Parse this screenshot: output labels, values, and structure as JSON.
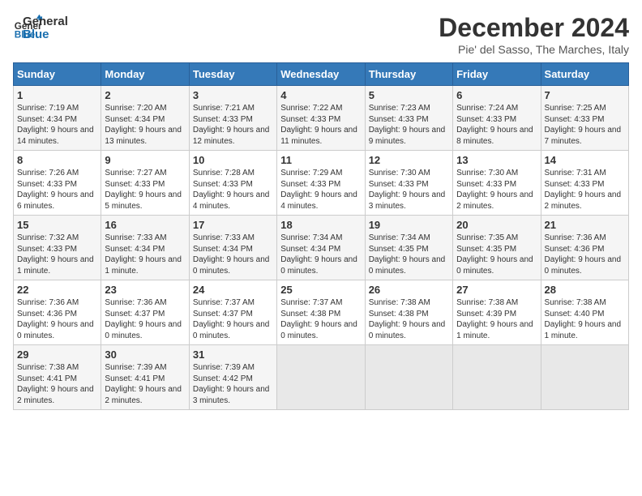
{
  "header": {
    "logo_general": "General",
    "logo_blue": "Blue",
    "main_title": "December 2024",
    "subtitle": "Pie' del Sasso, The Marches, Italy"
  },
  "weekdays": [
    "Sunday",
    "Monday",
    "Tuesday",
    "Wednesday",
    "Thursday",
    "Friday",
    "Saturday"
  ],
  "weeks": [
    [
      {
        "day": "1",
        "sunrise": "7:19 AM",
        "sunset": "4:34 PM",
        "daylight": "9 hours and 14 minutes."
      },
      {
        "day": "2",
        "sunrise": "7:20 AM",
        "sunset": "4:34 PM",
        "daylight": "9 hours and 13 minutes."
      },
      {
        "day": "3",
        "sunrise": "7:21 AM",
        "sunset": "4:33 PM",
        "daylight": "9 hours and 12 minutes."
      },
      {
        "day": "4",
        "sunrise": "7:22 AM",
        "sunset": "4:33 PM",
        "daylight": "9 hours and 11 minutes."
      },
      {
        "day": "5",
        "sunrise": "7:23 AM",
        "sunset": "4:33 PM",
        "daylight": "9 hours and 9 minutes."
      },
      {
        "day": "6",
        "sunrise": "7:24 AM",
        "sunset": "4:33 PM",
        "daylight": "9 hours and 8 minutes."
      },
      {
        "day": "7",
        "sunrise": "7:25 AM",
        "sunset": "4:33 PM",
        "daylight": "9 hours and 7 minutes."
      }
    ],
    [
      {
        "day": "8",
        "sunrise": "7:26 AM",
        "sunset": "4:33 PM",
        "daylight": "9 hours and 6 minutes."
      },
      {
        "day": "9",
        "sunrise": "7:27 AM",
        "sunset": "4:33 PM",
        "daylight": "9 hours and 5 minutes."
      },
      {
        "day": "10",
        "sunrise": "7:28 AM",
        "sunset": "4:33 PM",
        "daylight": "9 hours and 4 minutes."
      },
      {
        "day": "11",
        "sunrise": "7:29 AM",
        "sunset": "4:33 PM",
        "daylight": "9 hours and 4 minutes."
      },
      {
        "day": "12",
        "sunrise": "7:30 AM",
        "sunset": "4:33 PM",
        "daylight": "9 hours and 3 minutes."
      },
      {
        "day": "13",
        "sunrise": "7:30 AM",
        "sunset": "4:33 PM",
        "daylight": "9 hours and 2 minutes."
      },
      {
        "day": "14",
        "sunrise": "7:31 AM",
        "sunset": "4:33 PM",
        "daylight": "9 hours and 2 minutes."
      }
    ],
    [
      {
        "day": "15",
        "sunrise": "7:32 AM",
        "sunset": "4:33 PM",
        "daylight": "9 hours and 1 minute."
      },
      {
        "day": "16",
        "sunrise": "7:33 AM",
        "sunset": "4:34 PM",
        "daylight": "9 hours and 1 minute."
      },
      {
        "day": "17",
        "sunrise": "7:33 AM",
        "sunset": "4:34 PM",
        "daylight": "9 hours and 0 minutes."
      },
      {
        "day": "18",
        "sunrise": "7:34 AM",
        "sunset": "4:34 PM",
        "daylight": "9 hours and 0 minutes."
      },
      {
        "day": "19",
        "sunrise": "7:34 AM",
        "sunset": "4:35 PM",
        "daylight": "9 hours and 0 minutes."
      },
      {
        "day": "20",
        "sunrise": "7:35 AM",
        "sunset": "4:35 PM",
        "daylight": "9 hours and 0 minutes."
      },
      {
        "day": "21",
        "sunrise": "7:36 AM",
        "sunset": "4:36 PM",
        "daylight": "9 hours and 0 minutes."
      }
    ],
    [
      {
        "day": "22",
        "sunrise": "7:36 AM",
        "sunset": "4:36 PM",
        "daylight": "9 hours and 0 minutes."
      },
      {
        "day": "23",
        "sunrise": "7:36 AM",
        "sunset": "4:37 PM",
        "daylight": "9 hours and 0 minutes."
      },
      {
        "day": "24",
        "sunrise": "7:37 AM",
        "sunset": "4:37 PM",
        "daylight": "9 hours and 0 minutes."
      },
      {
        "day": "25",
        "sunrise": "7:37 AM",
        "sunset": "4:38 PM",
        "daylight": "9 hours and 0 minutes."
      },
      {
        "day": "26",
        "sunrise": "7:38 AM",
        "sunset": "4:38 PM",
        "daylight": "9 hours and 0 minutes."
      },
      {
        "day": "27",
        "sunrise": "7:38 AM",
        "sunset": "4:39 PM",
        "daylight": "9 hours and 1 minute."
      },
      {
        "day": "28",
        "sunrise": "7:38 AM",
        "sunset": "4:40 PM",
        "daylight": "9 hours and 1 minute."
      }
    ],
    [
      {
        "day": "29",
        "sunrise": "7:38 AM",
        "sunset": "4:41 PM",
        "daylight": "9 hours and 2 minutes."
      },
      {
        "day": "30",
        "sunrise": "7:39 AM",
        "sunset": "4:41 PM",
        "daylight": "9 hours and 2 minutes."
      },
      {
        "day": "31",
        "sunrise": "7:39 AM",
        "sunset": "4:42 PM",
        "daylight": "9 hours and 3 minutes."
      },
      null,
      null,
      null,
      null
    ]
  ]
}
